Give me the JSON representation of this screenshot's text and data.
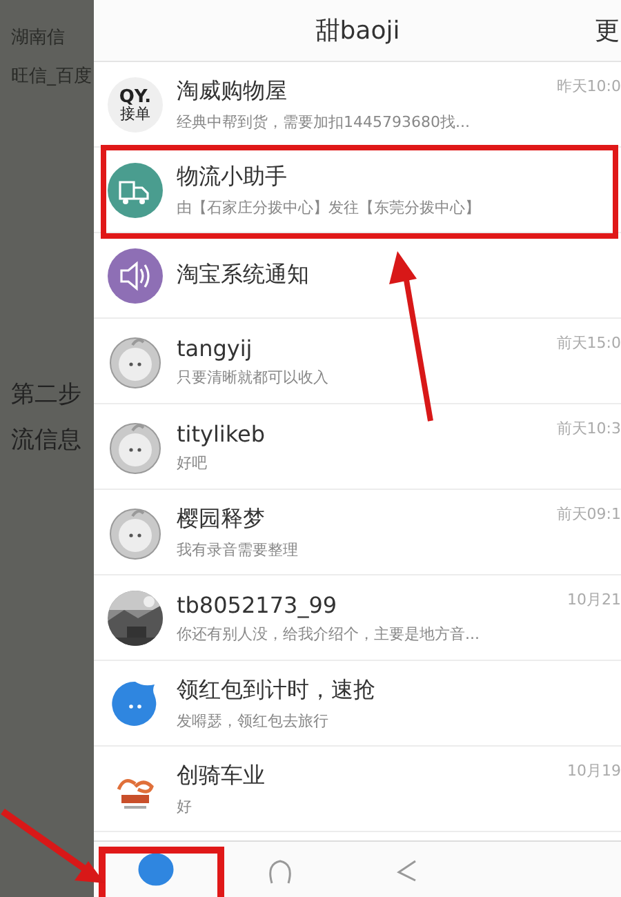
{
  "background_page": {
    "texts": [
      "湖南信",
      "旺信_百度",
      "第二步",
      "流信息"
    ]
  },
  "header": {
    "title": "甜baoji",
    "more": "更"
  },
  "conversations": [
    {
      "kind": "qy",
      "avatar_text": [
        "QY.",
        "接单"
      ],
      "name": "淘威购物屋",
      "preview": "经典中帮到货，需要加扣1445793680找...",
      "time": "昨天10:0"
    },
    {
      "kind": "truck",
      "name": "物流小助手",
      "preview": "由【石家庄分拨中心】发往【东莞分拨中心】"
    },
    {
      "kind": "speaker",
      "name": "淘宝系统通知"
    },
    {
      "kind": "bubble",
      "name": "tangyij",
      "preview": "只要清晰就都可以收入",
      "time": "前天15:0"
    },
    {
      "kind": "bubble",
      "name": "titylikeb",
      "preview": "好吧",
      "time": "前天10:3"
    },
    {
      "kind": "bubble",
      "name": "樱园释梦",
      "preview": "我有录音需要整理",
      "time": "前天09:1"
    },
    {
      "name": "tb8052173_99",
      "preview": "你还有别人没，给我介绍个，主要是地方音...",
      "time": "10月21"
    },
    {
      "kind": "filled-bubble",
      "name": "领红包到计时，速抢",
      "preview": "发嘚瑟，领红包去旅行"
    },
    {
      "kind": "brand",
      "name": "创骑车业",
      "preview": "好",
      "time": "10月19"
    }
  ],
  "tabs": [
    {
      "selected": true
    },
    {
      "selected": false
    },
    {
      "selected": false
    }
  ]
}
